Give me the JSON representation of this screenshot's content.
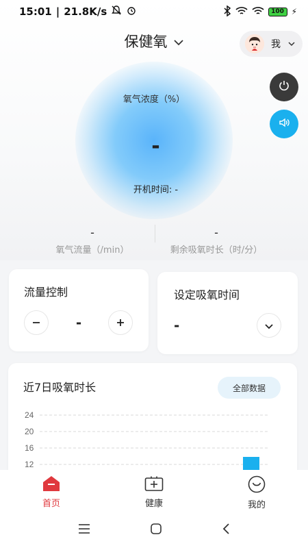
{
  "status_bar": {
    "time": "15:01",
    "net_speed": "21.8K/s",
    "battery": "100"
  },
  "header": {
    "title": "保健氧",
    "user_label": "我"
  },
  "oxygen": {
    "concentration_label": "氧气浓度（%）",
    "concentration_value": "-",
    "boot_time_label": "开机时间: -"
  },
  "stats": {
    "flow_value": "-",
    "flow_label": "氧气流量（/min）",
    "remaining_value": "-",
    "remaining_label": "剩余吸氧时长（时/分）"
  },
  "flow_card": {
    "title": "流量控制",
    "value": "-"
  },
  "time_card": {
    "title": "设定吸氧时间",
    "value": "-"
  },
  "history": {
    "title": "近7日吸氧时长",
    "all_data_label": "全部数据"
  },
  "chart_data": {
    "type": "bar",
    "y_ticks": [
      24,
      20,
      16,
      12
    ],
    "grid": "dashed",
    "bar_color": "#1ab0ee",
    "visible_bar_value_min": 12
  },
  "bottom_nav": {
    "items": [
      {
        "label": "首页",
        "active": true
      },
      {
        "label": "健康",
        "active": false
      },
      {
        "label": "我的",
        "active": false
      }
    ]
  },
  "colors": {
    "accent_red": "#e0393e",
    "power_button": "#3a3a3a",
    "sound_button": "#1ab0ee"
  }
}
